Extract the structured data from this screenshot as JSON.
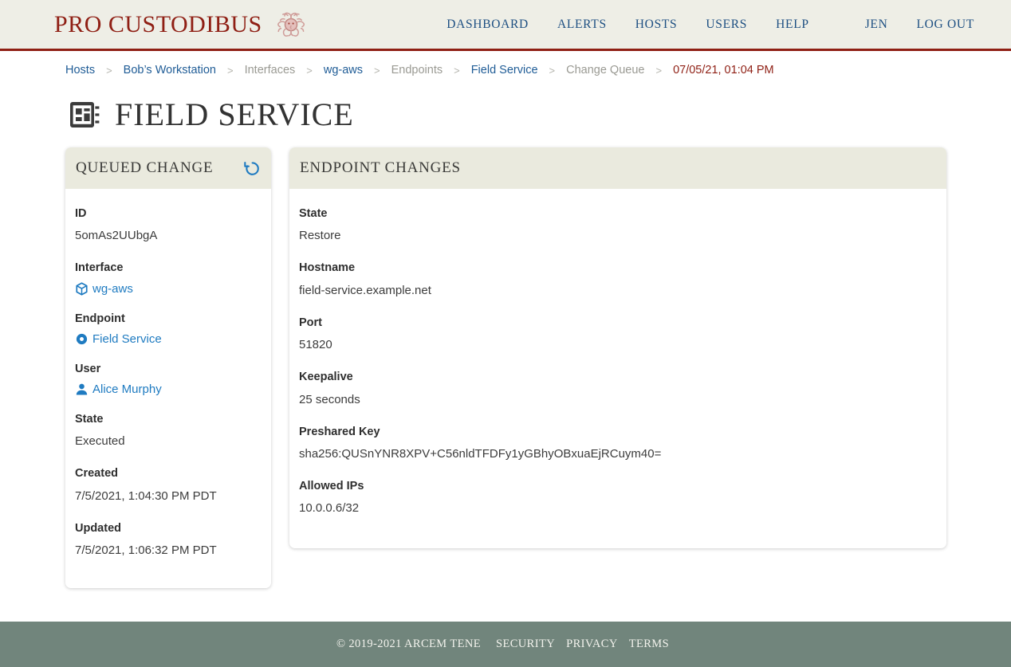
{
  "brand": {
    "name": "PRO CUSTODIBUS",
    "logo_icon": "medusa-head-logo"
  },
  "topnav": {
    "items": [
      {
        "label": "DASHBOARD",
        "name": "nav-dashboard"
      },
      {
        "label": "ALERTS",
        "name": "nav-alerts"
      },
      {
        "label": "HOSTS",
        "name": "nav-hosts"
      },
      {
        "label": "USERS",
        "name": "nav-users"
      },
      {
        "label": "HELP",
        "name": "nav-help"
      }
    ],
    "account": {
      "label": "JEN",
      "name": "nav-account-jen"
    },
    "logout": {
      "label": "LOG OUT",
      "name": "nav-log-out"
    }
  },
  "breadcrumb": {
    "items": [
      {
        "label": "Hosts",
        "kind": "link"
      },
      {
        "label": "Bob’s Workstation",
        "kind": "link"
      },
      {
        "label": "Interfaces",
        "kind": "muted"
      },
      {
        "label": "wg-aws",
        "kind": "link"
      },
      {
        "label": "Endpoints",
        "kind": "muted"
      },
      {
        "label": "Field Service",
        "kind": "link"
      },
      {
        "label": "Change Queue",
        "kind": "muted"
      },
      {
        "label": "07/05/21, 01:04 PM",
        "kind": "current"
      }
    ],
    "separator": ">"
  },
  "page": {
    "title": "FIELD SERVICE",
    "icon": "endpoint-chip-icon"
  },
  "queued_change": {
    "heading": "QUEUED CHANGE",
    "refresh_icon": "revert-circular-arrow-icon",
    "fields": [
      {
        "label": "ID",
        "value": "5omAs2UUbgA",
        "type": "text"
      },
      {
        "label": "Interface",
        "value": "wg-aws",
        "type": "link",
        "icon": "cube-icon"
      },
      {
        "label": "Endpoint",
        "value": "Field Service",
        "type": "link",
        "icon": "endpoint-dot-icon"
      },
      {
        "label": "User",
        "value": "Alice Murphy",
        "type": "link",
        "icon": "user-icon"
      },
      {
        "label": "State",
        "value": "Executed",
        "type": "text"
      },
      {
        "label": "Created",
        "value": "7/5/2021, 1:04:30 PM PDT",
        "type": "text"
      },
      {
        "label": "Updated",
        "value": "7/5/2021, 1:06:32 PM PDT",
        "type": "text"
      }
    ]
  },
  "endpoint_changes": {
    "heading": "ENDPOINT CHANGES",
    "fields": [
      {
        "label": "State",
        "value": "Restore"
      },
      {
        "label": "Hostname",
        "value": "field-service.example.net"
      },
      {
        "label": "Port",
        "value": "51820"
      },
      {
        "label": "Keepalive",
        "value": "25 seconds"
      },
      {
        "label": "Preshared Key",
        "value": "sha256:QUSnYNR8XPV+C56nldTFDFy1yGBhyOBxuaEjRCuym40="
      },
      {
        "label": "Allowed IPs",
        "value": "10.0.0.6/32"
      }
    ]
  },
  "footer": {
    "copyright": "© 2019-2021 ARCEM TENE",
    "links": [
      {
        "label": "SECURITY",
        "name": "footer-security"
      },
      {
        "label": "PRIVACY",
        "name": "footer-privacy"
      },
      {
        "label": "TERMS",
        "name": "footer-terms"
      }
    ]
  },
  "colors": {
    "brand_red": "#8f1f14",
    "nav_blue": "#1d4f82",
    "link_blue": "#1f7bc1",
    "header_bg": "#eeeee6",
    "card_head_bg": "#eaeade",
    "footer_bg": "#71857c"
  }
}
